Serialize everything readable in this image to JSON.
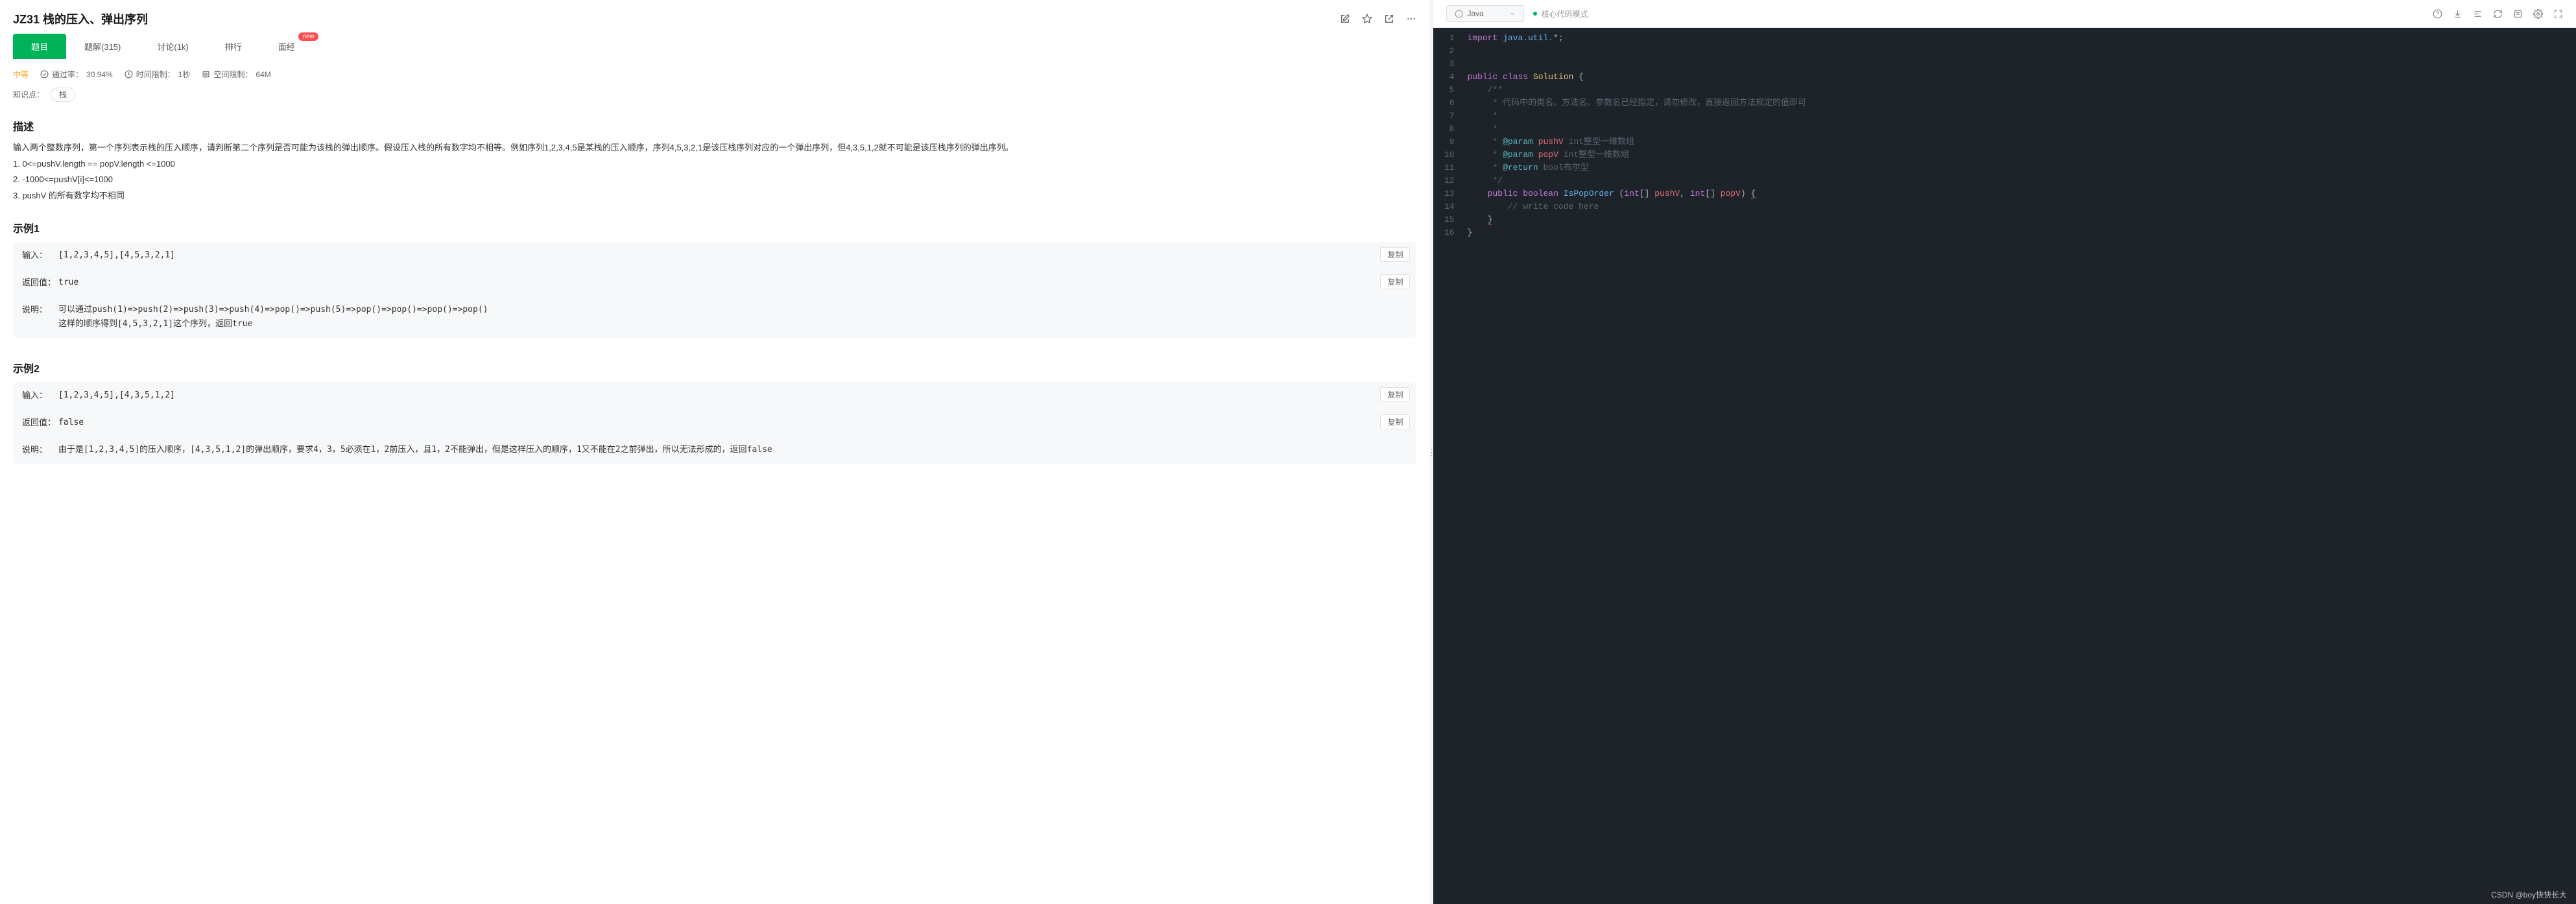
{
  "title": "JZ31 栈的压入、弹出序列",
  "tabs": [
    {
      "label": "题目",
      "active": true
    },
    {
      "label": "题解(315)"
    },
    {
      "label": "讨论(1k)"
    },
    {
      "label": "排行"
    },
    {
      "label": "面经",
      "badge": "new"
    }
  ],
  "meta": {
    "difficulty": "中等",
    "pass_label": "通过率：",
    "pass_value": "30.94%",
    "time_label": "时间限制：",
    "time_value": "1秒",
    "mem_label": "空间限制：",
    "mem_value": "64M"
  },
  "tags": {
    "label": "知识点：",
    "items": [
      "栈"
    ]
  },
  "desc": {
    "heading": "描述",
    "para": "输入两个整数序列，第一个序列表示栈的压入顺序，请判断第二个序列是否可能为该栈的弹出顺序。假设压入栈的所有数字均不相等。例如序列1,2,3,4,5是某栈的压入顺序，序列4,5,3,2,1是该压栈序列对应的一个弹出序列，但4,3,5,1,2就不可能是该压栈序列的弹出序列。",
    "list": [
      "1. 0<=pushV.length == popV.length <=1000",
      "2. -1000<=pushV[i]<=1000",
      "3. pushV 的所有数字均不相同"
    ]
  },
  "examples": [
    {
      "heading": "示例1",
      "rows": [
        {
          "label": "输入：",
          "value": "[1,2,3,4,5],[4,5,3,2,1]",
          "copy": true
        },
        {
          "label": "返回值：",
          "value": "true",
          "copy": true
        },
        {
          "label": "说明：",
          "value": "可以通过push(1)=>push(2)=>push(3)=>push(4)=>pop()=>push(5)=>pop()=>pop()=>pop()=>pop()\n这样的顺序得到[4,5,3,2,1]这个序列，返回true"
        }
      ]
    },
    {
      "heading": "示例2",
      "rows": [
        {
          "label": "输入：",
          "value": "[1,2,3,4,5],[4,3,5,1,2]",
          "copy": true
        },
        {
          "label": "返回值：",
          "value": "false",
          "copy": true
        },
        {
          "label": "说明：",
          "value": "由于是[1,2,3,4,5]的压入顺序，[4,3,5,1,2]的弹出顺序，要求4，3，5必须在1，2前压入，且1，2不能弹出，但是这样压入的顺序，1又不能在2之前弹出，所以无法形成的，返回false"
        }
      ]
    }
  ],
  "copy_label": "复制",
  "code_header": {
    "language": "Java",
    "mode": "核心代码模式"
  },
  "code_lines": [
    {
      "n": 1,
      "html": "<span class='tok-kw'>import</span> <span class='tok-type'>java.util.</span><span class='tok-pun'>*;</span>"
    },
    {
      "n": 2,
      "html": ""
    },
    {
      "n": 3,
      "html": ""
    },
    {
      "n": 4,
      "html": "<span class='tok-kw'>public</span> <span class='tok-kw'>class</span> <span class='tok-cls'>Solution</span> <span class='tok-pun'>{</span>"
    },
    {
      "n": 5,
      "html": "    <span class='tok-com'>/**</span>"
    },
    {
      "n": 6,
      "html": "     <span class='tok-com'>* 代码中的类名、方法名、参数名已经指定，请勿修改，直接返回方法规定的值即可</span>"
    },
    {
      "n": 7,
      "html": "     <span class='tok-com'>*</span>"
    },
    {
      "n": 8,
      "html": "     <span class='tok-com'>*</span>"
    },
    {
      "n": 9,
      "html": "     <span class='tok-com'>* <span class='tok-ann'>@param</span> <span class='tok-var'>pushV</span> int整型一维数组</span>"
    },
    {
      "n": 10,
      "html": "     <span class='tok-com'>* <span class='tok-ann'>@param</span> <span class='tok-var'>popV</span> int整型一维数组</span>"
    },
    {
      "n": 11,
      "html": "     <span class='tok-com'>* <span class='tok-ann'>@return</span> bool布尔型</span>"
    },
    {
      "n": 12,
      "html": "     <span class='tok-com'>*/</span>"
    },
    {
      "n": 13,
      "html": "    <span class='tok-kw'>public</span> <span class='tok-kw'>boolean</span> <span class='tok-fn'>IsPopOrder</span> <span class='tok-pun'>(</span><span class='tok-kw'>int</span><span class='tok-pun'>[]</span> <span class='tok-var'>pushV</span><span class='tok-pun'>,</span> <span class='tok-kw'>int</span><span class='tok-pun'>[]</span> <span class='tok-var'>popV</span><span class='tok-pun'>)</span> <span class='err-underline tok-pun'>{</span>"
    },
    {
      "n": 14,
      "html": "        <span class='tok-com'>// write code here</span>"
    },
    {
      "n": 15,
      "html": "    <span class='err-underline tok-pun'>}</span>"
    },
    {
      "n": 16,
      "html": "<span class='tok-pun'>}</span>"
    }
  ],
  "watermark": "CSDN @boy快快长大"
}
